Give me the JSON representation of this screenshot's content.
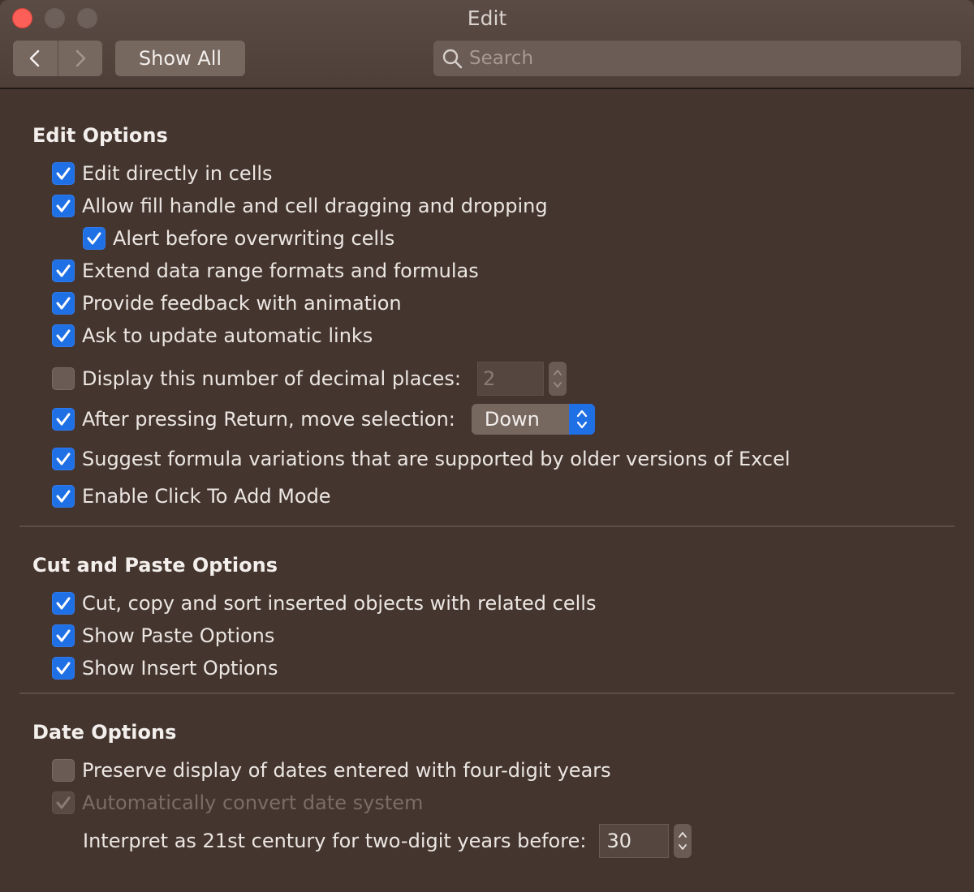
{
  "window": {
    "title": "Edit"
  },
  "toolbar": {
    "show_all_label": "Show All",
    "search_placeholder": "Search"
  },
  "edit_options": {
    "title": "Edit Options",
    "items": [
      {
        "label": "Edit directly in cells",
        "checked": true
      },
      {
        "label": "Allow fill handle and cell dragging and dropping",
        "checked": true
      },
      {
        "label": "Alert before overwriting cells",
        "checked": true
      },
      {
        "label": "Extend data range formats and formulas",
        "checked": true
      },
      {
        "label": "Provide feedback with animation",
        "checked": true
      },
      {
        "label": "Ask to update automatic links",
        "checked": true
      },
      {
        "label": "Display this number of decimal places:",
        "checked": false,
        "value": "2"
      },
      {
        "label": "After pressing Return, move selection:",
        "checked": true,
        "value": "Down"
      },
      {
        "label": "Suggest formula variations that are supported by older versions of Excel",
        "checked": true
      },
      {
        "label": "Enable Click To Add Mode",
        "checked": true
      }
    ]
  },
  "cut_paste_options": {
    "title": "Cut and Paste Options",
    "items": [
      {
        "label": "Cut, copy and sort inserted objects with related cells",
        "checked": true
      },
      {
        "label": "Show Paste Options",
        "checked": true
      },
      {
        "label": "Show Insert Options",
        "checked": true
      }
    ]
  },
  "date_options": {
    "title": "Date Options",
    "items": [
      {
        "label": "Preserve display of dates entered with four-digit years",
        "checked": false
      },
      {
        "label": "Automatically convert date system",
        "checked": true,
        "disabled": true
      }
    ],
    "interpret_label": "Interpret as 21st century for two-digit years before:",
    "interpret_value": "30"
  }
}
